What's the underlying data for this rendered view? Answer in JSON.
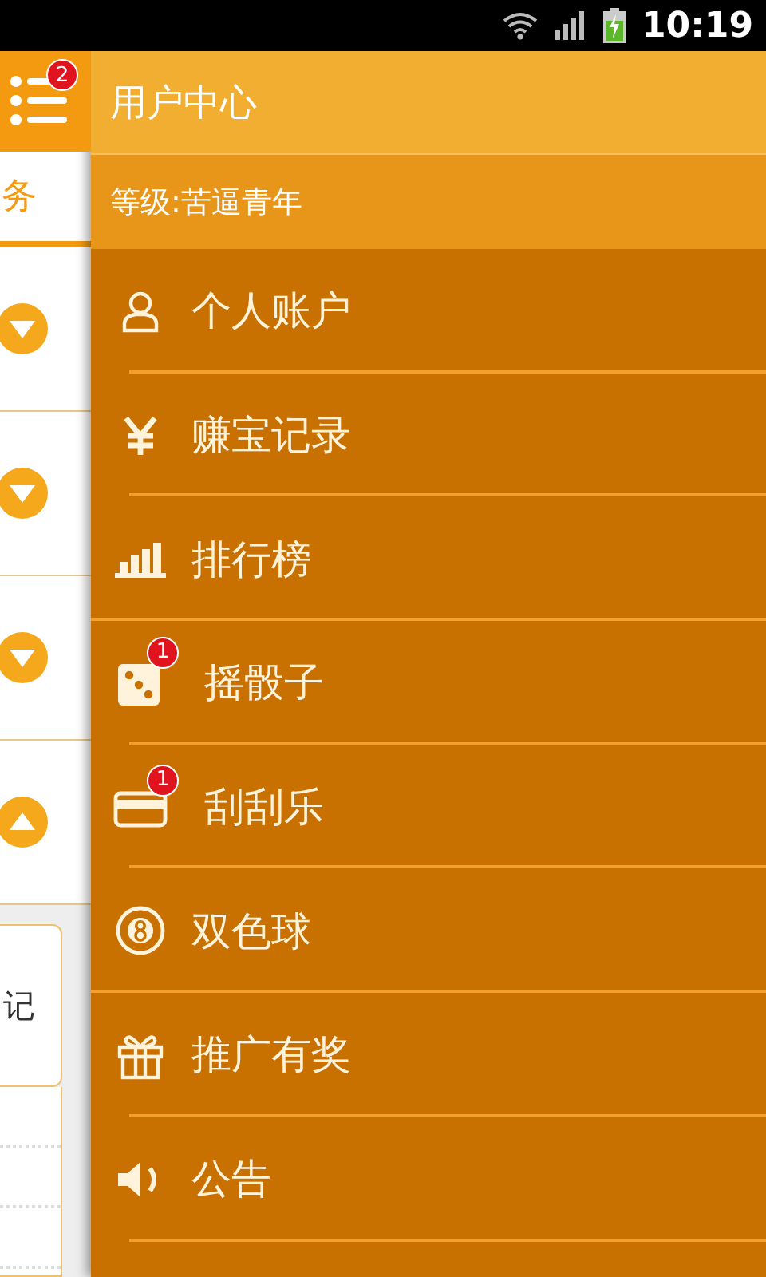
{
  "status_bar": {
    "time": "10:19"
  },
  "background_app": {
    "menu_badge": "2",
    "tab_label": "务",
    "rows": [
      {
        "expanded": false
      },
      {
        "expanded": false
      },
      {
        "expanded": false
      },
      {
        "expanded": true
      }
    ],
    "card_text": "记"
  },
  "drawer": {
    "title": "用户中心",
    "level_text": "等级:苦逼青年",
    "items": [
      {
        "kind": "person",
        "label": "个人账户",
        "section_end": false
      },
      {
        "kind": "yen",
        "label": "赚宝记录",
        "section_end": false
      },
      {
        "kind": "chart",
        "label": "排行榜",
        "section_end": true
      },
      {
        "kind": "dice",
        "label": "摇骰子",
        "badge": "1",
        "section_end": false
      },
      {
        "kind": "card",
        "label": "刮刮乐",
        "badge": "1",
        "section_end": false
      },
      {
        "kind": "ball",
        "label": "双色球",
        "section_end": true
      },
      {
        "kind": "gift",
        "label": "推广有奖",
        "section_end": false
      },
      {
        "kind": "speaker",
        "label": "公告",
        "section_end": false
      }
    ]
  }
}
